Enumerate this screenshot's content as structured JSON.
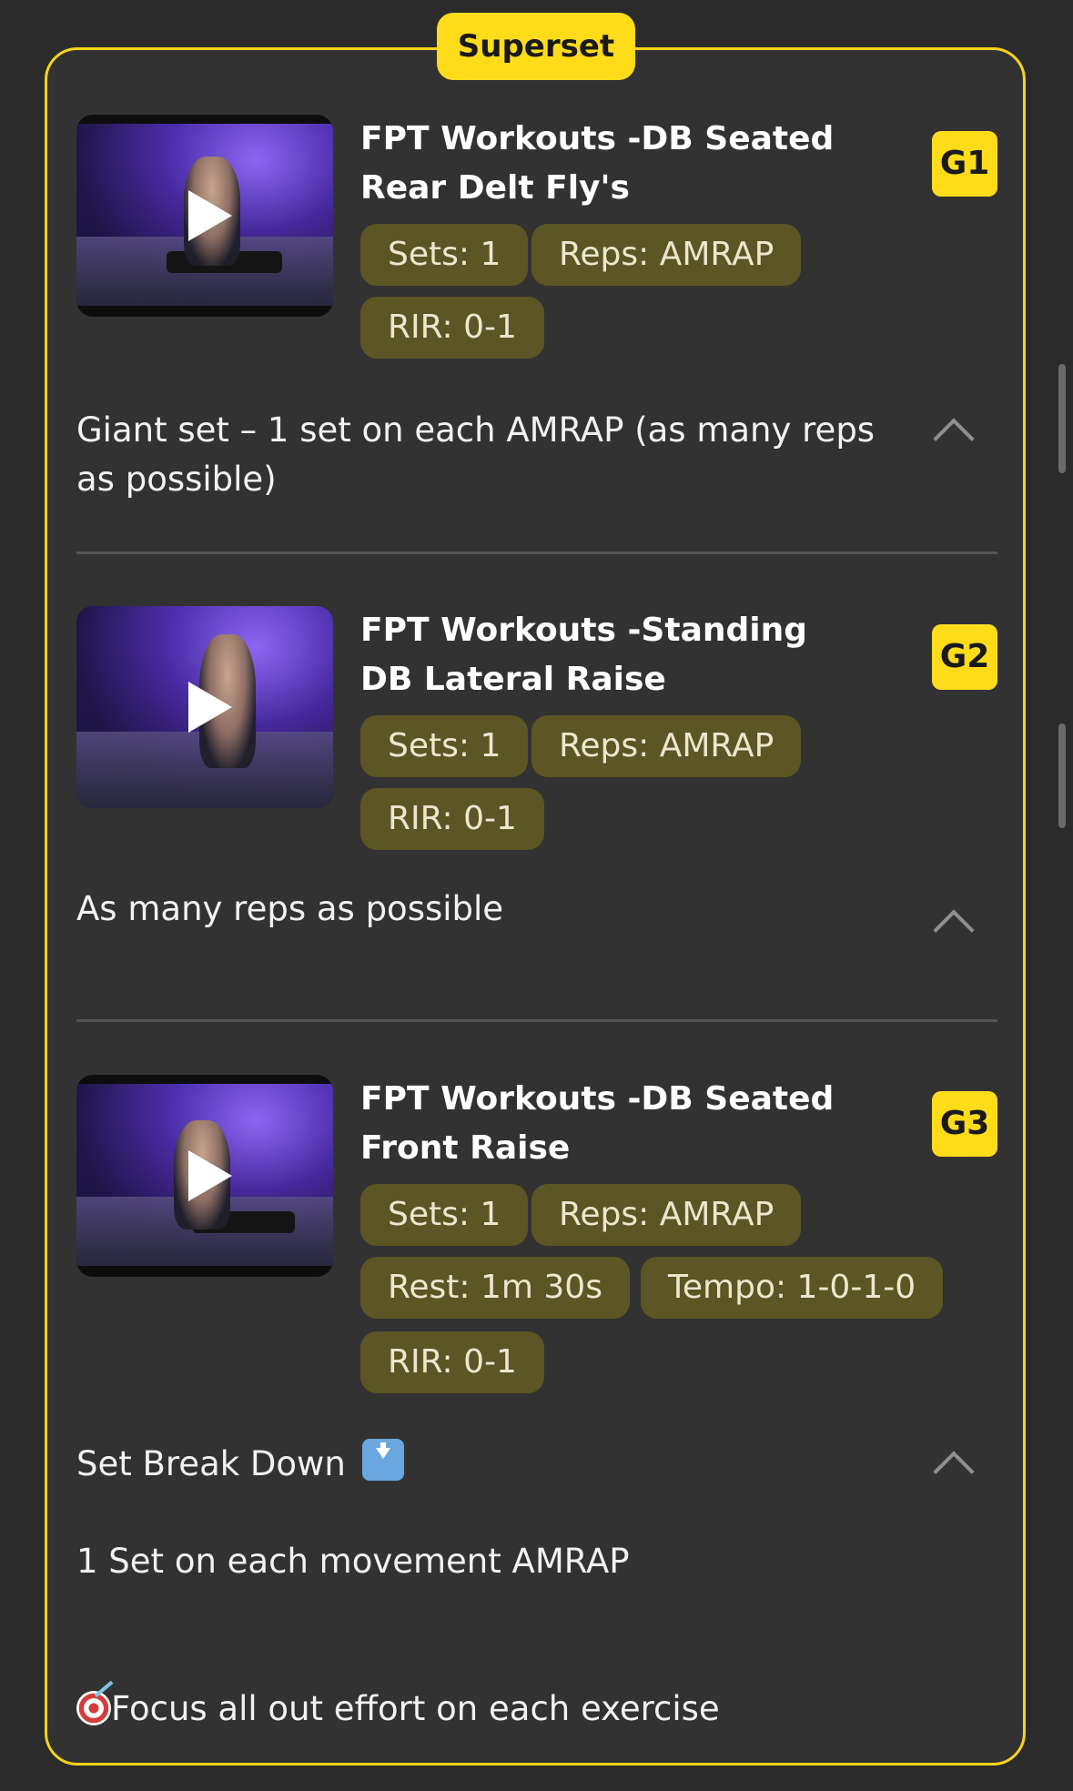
{
  "superset_label": "Superset",
  "exercises": [
    {
      "title": "FPT Workouts -DB Seated Rear Delt Fly's",
      "group": "G1",
      "chips": [
        "Sets: 1",
        "Reps: AMRAP",
        "RIR: 0-1"
      ],
      "note": "Giant set – 1 set on each AMRAP (as many reps as possible)"
    },
    {
      "title": "FPT Workouts -Standing DB Lateral Raise",
      "group": "G2",
      "chips": [
        "Sets: 1",
        "Reps: AMRAP",
        "RIR: 0-1"
      ],
      "note": "As many reps as possible"
    },
    {
      "title": "FPT Workouts -DB Seated Front Raise",
      "group": "G3",
      "chips": [
        "Sets: 1",
        "Reps: AMRAP",
        "Rest: 1m 30s",
        "Tempo: 1-0-1-0",
        "RIR: 0-1"
      ],
      "note_heading": "Set Break Down",
      "note_line1": "1 Set on each movement AMRAP",
      "note_line2": "Focus all out effort on each exercise"
    }
  ],
  "icons": {
    "play": "play-icon",
    "chevron": "chevron-up-icon",
    "down_arrow": "down-arrow-emoji-icon",
    "target": "dart-target-emoji-icon"
  },
  "colors": {
    "accent": "#ffdc1a",
    "chip_bg": "#5c5524",
    "background": "#2b2b2b",
    "card_bg": "#323232"
  }
}
